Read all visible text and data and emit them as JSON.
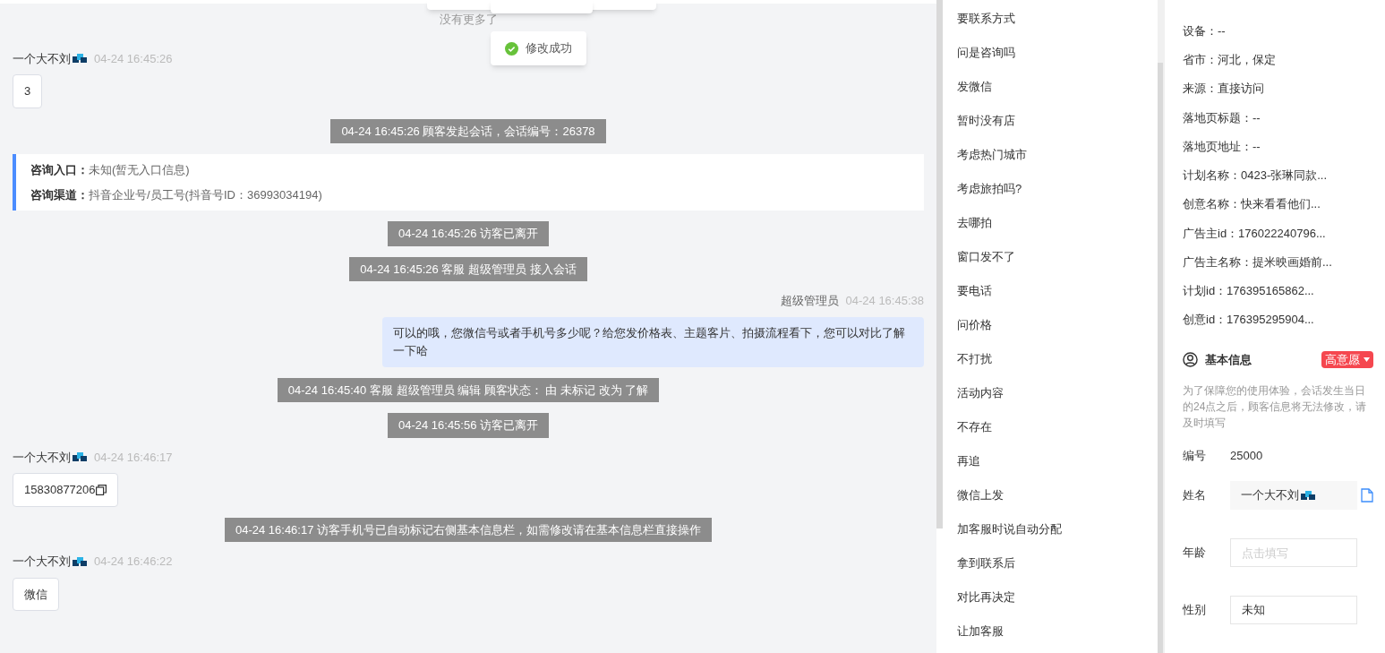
{
  "chat": {
    "no_more": "没有更多了",
    "messages": [
      {
        "kind": "visitor",
        "name": "一个大不刘",
        "time": "04-24 16:45:26",
        "text": "3"
      },
      {
        "kind": "system",
        "text": "04-24 16:45:26 顾客发起会话，会话编号：26378"
      },
      {
        "kind": "entry",
        "lines": [
          {
            "label": "咨询入口：",
            "value": "未知(暂无入口信息)"
          },
          {
            "label": "咨询渠道：",
            "value": "抖音企业号/员工号(抖音号ID：36993034194)"
          }
        ]
      },
      {
        "kind": "system",
        "text": "04-24 16:45:26 访客已离开"
      },
      {
        "kind": "system",
        "text": "04-24 16:45:26 客服 超级管理员 接入会话"
      },
      {
        "kind": "agent",
        "name": "超级管理员",
        "time": "04-24 16:45:38",
        "text": "可以的哦，您微信号或者手机号多少呢？给您发价格表、主题客片、拍摄流程看下，您可以对比了解一下哈"
      },
      {
        "kind": "system",
        "text": "04-24 16:45:40 客服 超级管理员 编辑 顾客状态： 由 未标记 改为 了解"
      },
      {
        "kind": "system",
        "text": "04-24 16:45:56 访客已离开"
      },
      {
        "kind": "visitor",
        "name": "一个大不刘",
        "time": "04-24 16:46:17",
        "text": "15830877206",
        "copy": true
      },
      {
        "kind": "system",
        "text": "04-24 16:46:17 访客手机号已自动标记右侧基本信息栏，如需修改请在基本信息栏直接操作"
      },
      {
        "kind": "visitor",
        "name": "一个大不刘",
        "time": "04-24 16:46:22",
        "text": "微信"
      }
    ]
  },
  "toast": {
    "text": "修改成功"
  },
  "quick_replies": [
    "要联系方式",
    "问是咨询吗",
    "发微信",
    "暂时没有店",
    "考虑热门城市",
    "考虑旅拍吗?",
    "去哪拍",
    "窗口发不了",
    "要电话",
    "问价格",
    "不打扰",
    "活动内容",
    "不存在",
    "再追",
    "微信上发",
    "加客服时说自动分配",
    "拿到联系后",
    "对比再决定",
    "让加客服"
  ],
  "source_info": [
    "设备：--",
    "省市：河北，保定",
    "来源：直接访问",
    "落地页标题：--",
    "落地页地址：--",
    "计划名称：0423-张琳同款...",
    "创意名称：快来看看他们...",
    "广告主id：176022240796...",
    "广告主名称：提米映画婚前...",
    "计划id：176395165862...",
    "创意id：176395295904..."
  ],
  "basic_info": {
    "title": "基本信息",
    "intent": "高意愿",
    "notice": "为了保障您的使用体验，会话发生当日的24点之后，顾客信息将无法修改，请及时填写",
    "fields": [
      {
        "kind": "text",
        "label": "编号",
        "value": "25000"
      },
      {
        "kind": "readonly",
        "label": "姓名",
        "value": "一个大不刘"
      },
      {
        "kind": "input",
        "label": "年龄",
        "placeholder": "点击填写"
      },
      {
        "kind": "input",
        "label": "性别",
        "value": "未知"
      }
    ]
  }
}
